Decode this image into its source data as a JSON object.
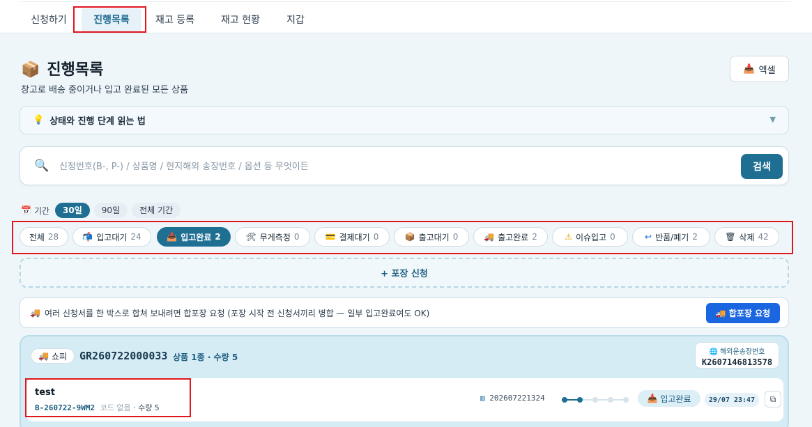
{
  "tabs": [
    {
      "label": "신청하기"
    },
    {
      "label": "진행목록"
    },
    {
      "label": "재고 등록"
    },
    {
      "label": "재고 현황"
    },
    {
      "label": "지갑"
    }
  ],
  "page": {
    "title": "진행목록",
    "subtitle": "창고로 배송 중이거나 입고 완료된 모든 상품",
    "excel_label": "엑셀"
  },
  "guide": {
    "label": "상태와 진행 단계 읽는 법"
  },
  "search": {
    "placeholder": "신청번호(B-, P-) / 상품명 / 현지해외 송장번호 / 옵션 등 무엇이든",
    "button": "검색"
  },
  "period": {
    "label": "기간",
    "options": [
      "30일",
      "90일",
      "전체 기간"
    ],
    "selected": "30일"
  },
  "statuses": [
    {
      "label": "전체",
      "count": "28",
      "icon": "",
      "active": false
    },
    {
      "label": "입고대기",
      "count": "24",
      "icon": "📬",
      "active": false
    },
    {
      "label": "입고완료",
      "count": "2",
      "icon": "📥",
      "active": true
    },
    {
      "label": "무게측정",
      "count": "0",
      "icon": "🛠",
      "active": false
    },
    {
      "label": "결제대기",
      "count": "0",
      "icon": "💳",
      "active": false
    },
    {
      "label": "출고대기",
      "count": "0",
      "icon": "📦",
      "active": false
    },
    {
      "label": "출고완료",
      "count": "2",
      "icon": "🚚",
      "active": false
    },
    {
      "label": "이슈입고",
      "count": "0",
      "icon": "⚠",
      "active": false
    },
    {
      "label": "반품/폐기",
      "count": "2",
      "icon": "↩",
      "active": false
    },
    {
      "label": "삭제",
      "count": "42",
      "icon": "🗑",
      "active": false
    }
  ],
  "add_pack": {
    "label": "+ 포장 신청"
  },
  "merge": {
    "text": "여러 신청서를 한 박스로 합쳐 보내려면 합포장 요청 (포장 시작 전 신청서끼리 병합 — 일부 입고완료여도 OK)",
    "button": "합포장 요청"
  },
  "group": {
    "shop": "쇼피",
    "group_no": "GR260722000033",
    "meta": "상품 1종 · 수량 5",
    "tracking_label": "해외운송장번호",
    "tracking_no": "K2607146813578",
    "item": {
      "name": "test",
      "code": "B-260722-9WM2",
      "no_code": "코드 없음",
      "qty": "· 수량 5",
      "order_no": "202607221324",
      "stage": "입고완료",
      "stage_index": 2,
      "stage_total": 5,
      "date": "29/07 23:47"
    }
  },
  "colors": {
    "accent": "#1f6f93",
    "merge_button": "#1a66e0",
    "highlight_box": "#e0161c"
  }
}
